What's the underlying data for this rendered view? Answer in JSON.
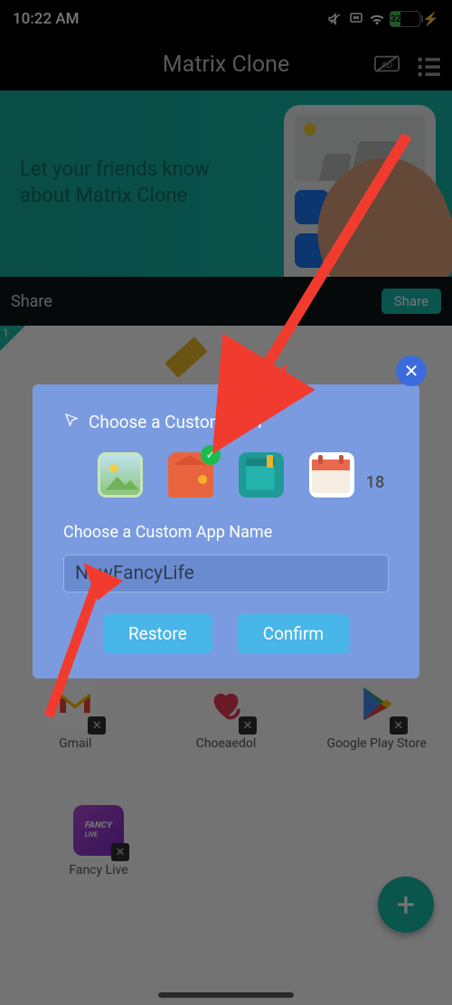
{
  "status": {
    "time": "10:22 AM",
    "battery_pct": "32"
  },
  "header": {
    "title": "Matrix Clone"
  },
  "banner": {
    "line1": "Let your friends know",
    "line2": "about Matrix Clone"
  },
  "share_bar": {
    "label": "Share",
    "button": "Share"
  },
  "apps": {
    "row1": [
      {
        "name": "Gmail"
      },
      {
        "name": "Choeaedol"
      },
      {
        "name": "Google Play Store"
      }
    ],
    "row2": [
      {
        "name": "Fancy Live"
      }
    ]
  },
  "modal": {
    "title": "Choose a Custom Icon",
    "label": "Choose a Custom App Name",
    "input_value": "NewFancyLife",
    "restore": "Restore",
    "confirm": "Confirm",
    "calendar_day": "18"
  },
  "corner_badge": "1"
}
